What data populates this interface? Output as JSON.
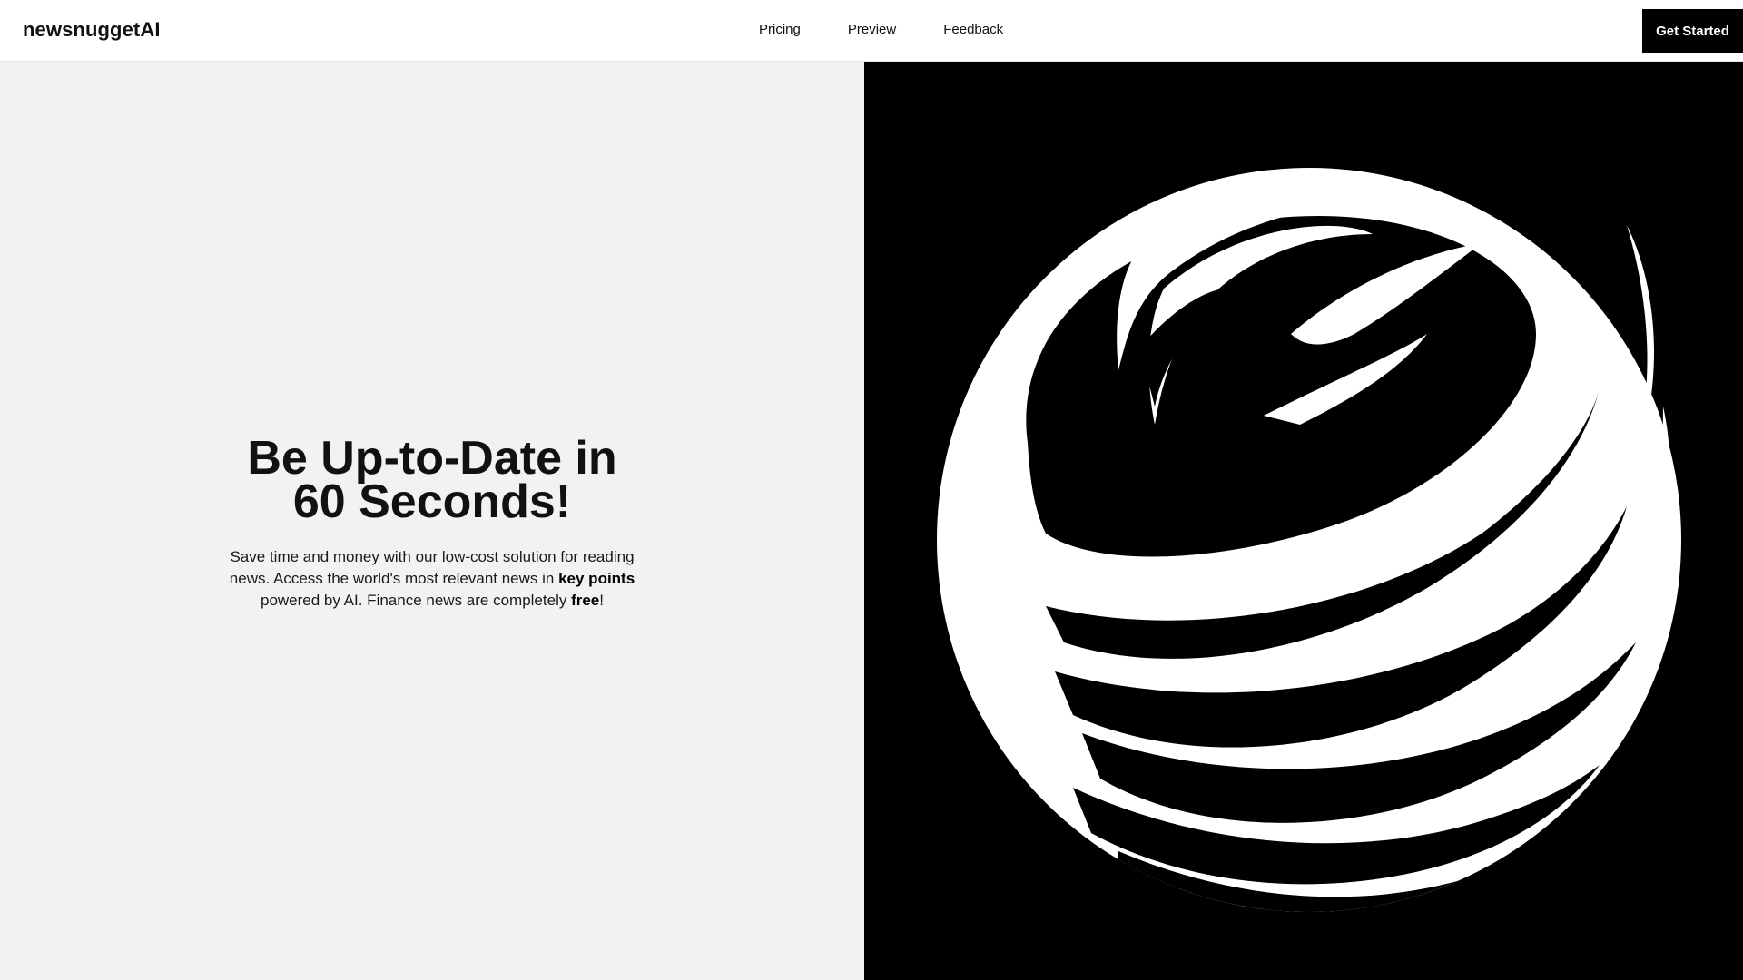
{
  "nav": {
    "brand": "newsnuggetAI",
    "links": [
      "Pricing",
      "Preview",
      "Feedback"
    ],
    "cta_label": "Get Started"
  },
  "hero": {
    "title_line1": "Be Up-to-Date in",
    "title_line2": "60 Seconds!",
    "desc_part1": "Save time and money with our low-cost solution for reading news. Access the world's most relevant news in ",
    "desc_bold1": "key points",
    "desc_part2": " powered by AI. Finance news are completely ",
    "desc_bold2": "free",
    "desc_part3": "!"
  },
  "colors": {
    "nav_bg": "#ffffff",
    "left_panel_bg": "#f2f2f2",
    "right_panel_bg": "#000000",
    "cta_bg": "#000000",
    "cta_text": "#ffffff",
    "text": "#111111"
  },
  "illustration": {
    "name": "abstract-globe-illustration",
    "colors": [
      "#000000",
      "#ffffff"
    ]
  }
}
